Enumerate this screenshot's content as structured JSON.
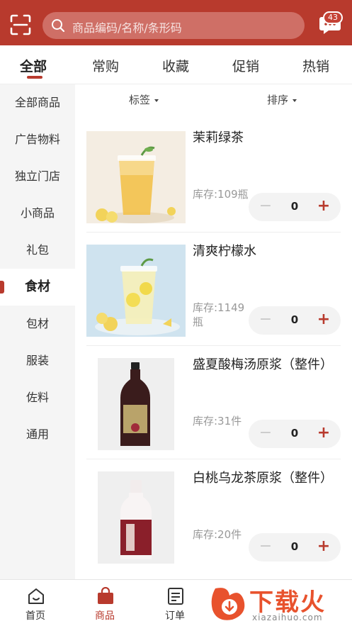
{
  "header": {
    "search_placeholder": "商品编码/名称/条形码",
    "message_badge": "43"
  },
  "tabs": [
    "全部",
    "常购",
    "收藏",
    "促销",
    "热销"
  ],
  "sidebar": [
    "全部商品",
    "广告物料",
    "独立门店",
    "小商品",
    "礼包",
    "食材",
    "包材",
    "服装",
    "佐料",
    "通用"
  ],
  "filters": {
    "tag": "标签",
    "sort": "排序"
  },
  "products": [
    {
      "name": "茉莉绿茶",
      "stock": "库存:109瓶",
      "qty": "0"
    },
    {
      "name": "清爽柠檬水",
      "stock": "库存:1149瓶",
      "qty": "0"
    },
    {
      "name": "盛夏酸梅汤原浆（整件）",
      "stock": "库存:31件",
      "qty": "0"
    },
    {
      "name": "白桃乌龙茶原浆（整件）",
      "stock": "库存:20件",
      "qty": "0"
    }
  ],
  "bottom_nav": [
    "首页",
    "商品",
    "订单"
  ],
  "watermark": {
    "title": "下载火",
    "sub": "xiazaihuo.com"
  },
  "colors": {
    "brand": "#b83a2d"
  }
}
